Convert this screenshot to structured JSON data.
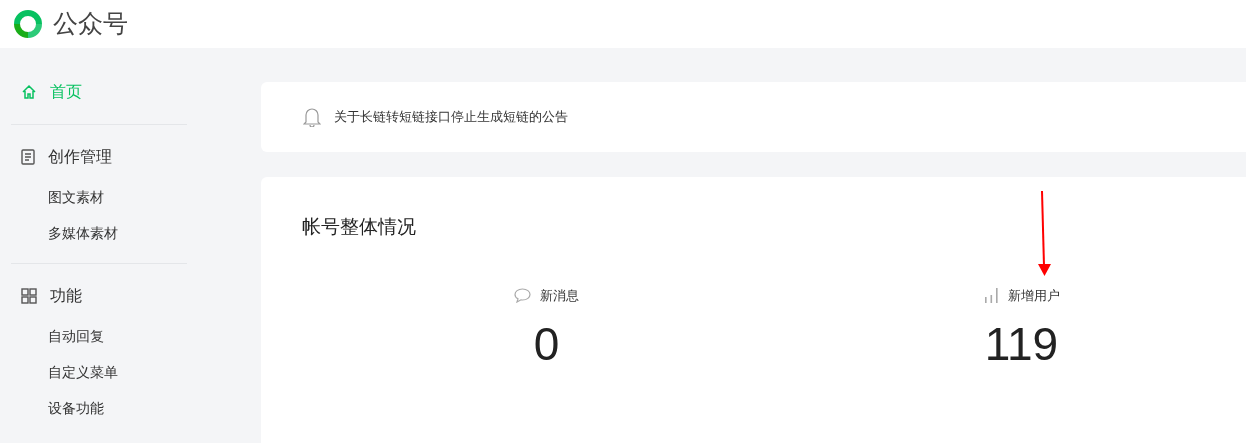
{
  "header": {
    "title": "公众号"
  },
  "sidebar": {
    "groups": [
      {
        "title": "首页",
        "kind": "home",
        "selected": true
      },
      {
        "title": "创作管理",
        "kind": "doc",
        "selected": false,
        "items": [
          {
            "label": "图文素材",
            "selected": false
          },
          {
            "label": "多媒体素材",
            "selected": false
          }
        ]
      },
      {
        "title": "功能",
        "kind": "grid",
        "selected": false,
        "items": [
          {
            "label": "自动回复",
            "selected": false
          },
          {
            "label": "自定义菜单",
            "selected": false
          },
          {
            "label": "设备功能",
            "selected": false
          }
        ]
      }
    ]
  },
  "notice": {
    "text": "关于长链转短链接口停止生成短链的公告"
  },
  "overview": {
    "title": "帐号整体情况",
    "stats": [
      {
        "kind": "message",
        "label": "新消息",
        "value": "0"
      },
      {
        "kind": "chart",
        "label": "新增用户",
        "value": "119"
      }
    ]
  }
}
